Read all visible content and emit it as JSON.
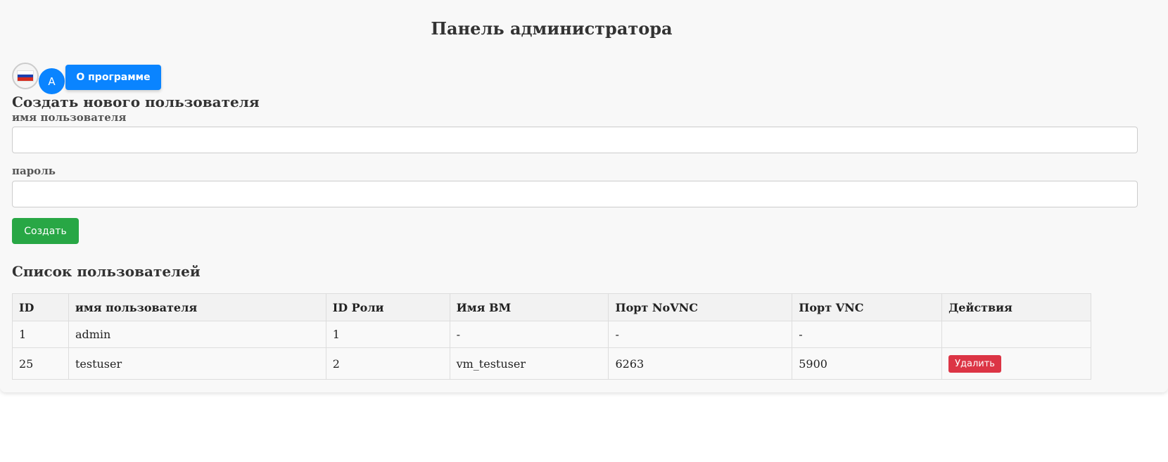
{
  "header": {
    "title": "Панель администратора"
  },
  "toolbar": {
    "language_icon": "russia-flag-icon",
    "avatar_letter": "A",
    "about_label": "О программе",
    "accent_color": "#0a84ff"
  },
  "create_form": {
    "title": "Создать нового пользователя",
    "username_label": "имя пользователя",
    "username_value": "",
    "password_label": "пароль",
    "password_value": "",
    "submit_label": "Создать",
    "submit_color": "#28a745"
  },
  "users": {
    "title": "Список пользователей",
    "columns": [
      "ID",
      "имя пользователя",
      "ID Роли",
      "Имя ВМ",
      "Порт NoVNC",
      "Порт VNC",
      "Действия"
    ],
    "rows": [
      {
        "id": "1",
        "username": "admin",
        "role_id": "1",
        "vm_name": "-",
        "novnc_port": "-",
        "vnc_port": "-",
        "action": ""
      },
      {
        "id": "25",
        "username": "testuser",
        "role_id": "2",
        "vm_name": "vm_testuser",
        "novnc_port": "6263",
        "vnc_port": "5900",
        "action": "Удалить"
      }
    ],
    "delete_color": "#dc3545"
  }
}
